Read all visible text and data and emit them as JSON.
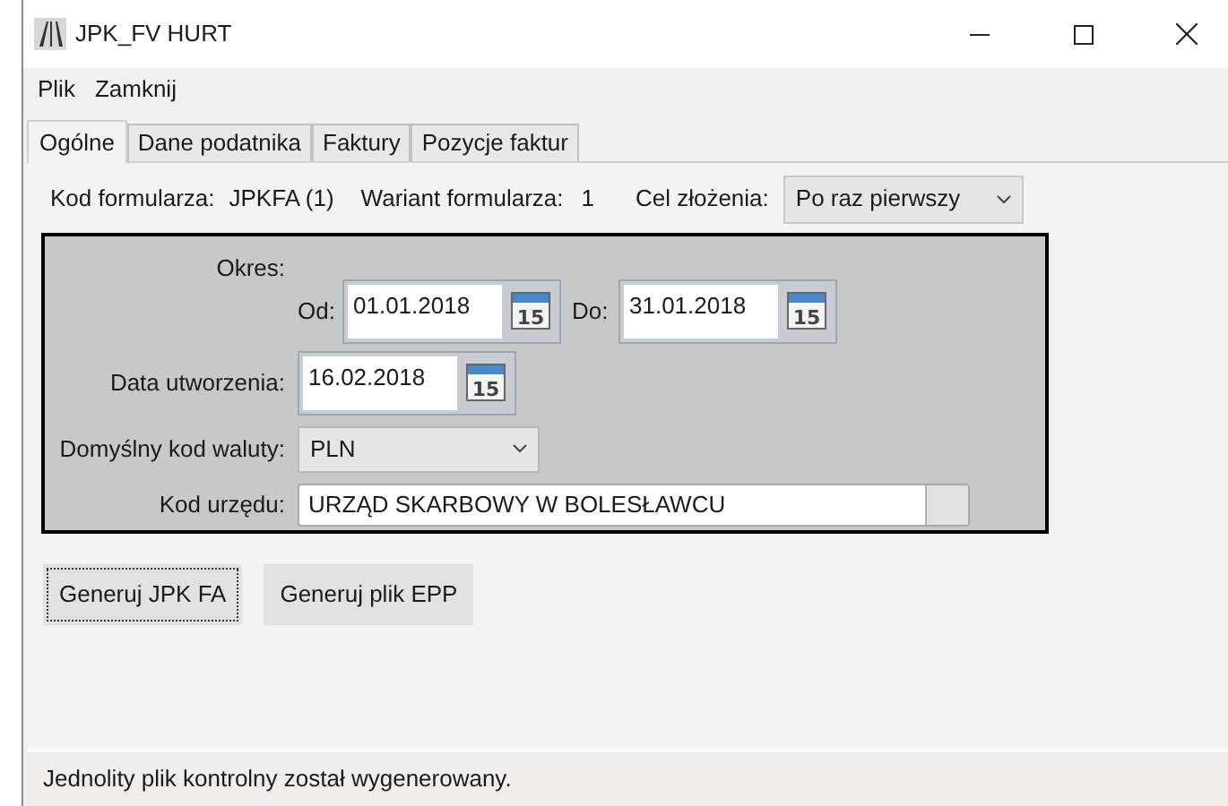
{
  "window": {
    "title": "JPK_FV HURT"
  },
  "menu": [
    {
      "label": "Plik"
    },
    {
      "label": "Zamknij"
    }
  ],
  "tabs": [
    {
      "label": "Ogólne",
      "selected": true
    },
    {
      "label": "Dane podatnika",
      "selected": false
    },
    {
      "label": "Faktury",
      "selected": false
    },
    {
      "label": "Pozycje faktur",
      "selected": false
    }
  ],
  "header": {
    "form_code_label": "Kod formularza:",
    "form_code": "JPKFA (1)",
    "variant_label": "Wariant formularza:",
    "variant": "1",
    "purpose_label": "Cel złożenia:",
    "purpose": "Po raz pierwszy"
  },
  "period": {
    "label": "Okres:",
    "from_label": "Od:",
    "from": "01.01.2018",
    "from_calendar_day": "15",
    "to_label": "Do:",
    "to": "31.01.2018",
    "to_calendar_day": "15"
  },
  "created": {
    "label": "Data utworzenia:",
    "value": "16.02.2018",
    "calendar_day": "15"
  },
  "currency": {
    "label": "Domyślny kod waluty:",
    "value": "PLN"
  },
  "office": {
    "label": "Kod urzędu:",
    "value": "URZĄD SKARBOWY W BOLESŁAWCU"
  },
  "buttons": [
    {
      "label": "Generuj JPK FA",
      "focused": true
    },
    {
      "label": "Generuj plik EPP",
      "focused": false
    }
  ],
  "status_bar": "Jednolity plik kontrolny został wygenerowany."
}
